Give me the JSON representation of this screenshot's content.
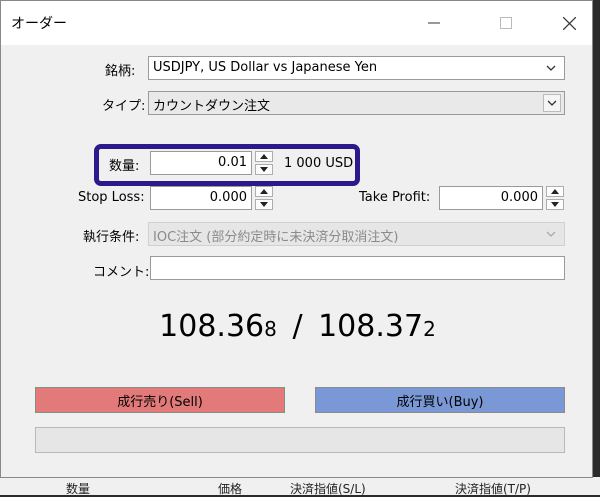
{
  "window": {
    "title": "オーダー"
  },
  "symbol": {
    "label": "銘柄:",
    "value": "USDJPY, US Dollar vs Japanese Yen"
  },
  "type": {
    "label": "タイプ:",
    "value": "カウントダウン注文"
  },
  "volume": {
    "label": "数量:",
    "value": "0.01",
    "unit_text": "1 000 USD"
  },
  "stop_loss": {
    "label": "Stop Loss:",
    "value": "0.000"
  },
  "take_profit": {
    "label": "Take Profit:",
    "value": "0.000"
  },
  "fill_policy": {
    "label": "執行条件:",
    "value": "IOC注文 (部分約定時に未決済分取消注文)"
  },
  "comment": {
    "label": "コメント:",
    "value": ""
  },
  "quote": {
    "bid_main": "108.36",
    "bid_small": "8",
    "separator": "/",
    "ask_main": "108.37",
    "ask_small": "2"
  },
  "buttons": {
    "sell": "成行売り(Sell)",
    "buy": "成行買い(Buy)"
  },
  "colors": {
    "highlight": "#2a1a8c",
    "sell": "#e27a7a",
    "buy": "#7b98d6"
  },
  "background": {
    "text1": "数量",
    "text2": "価格",
    "text3": "決済指値(S/L)",
    "text4": "決済指値(T/P)"
  }
}
